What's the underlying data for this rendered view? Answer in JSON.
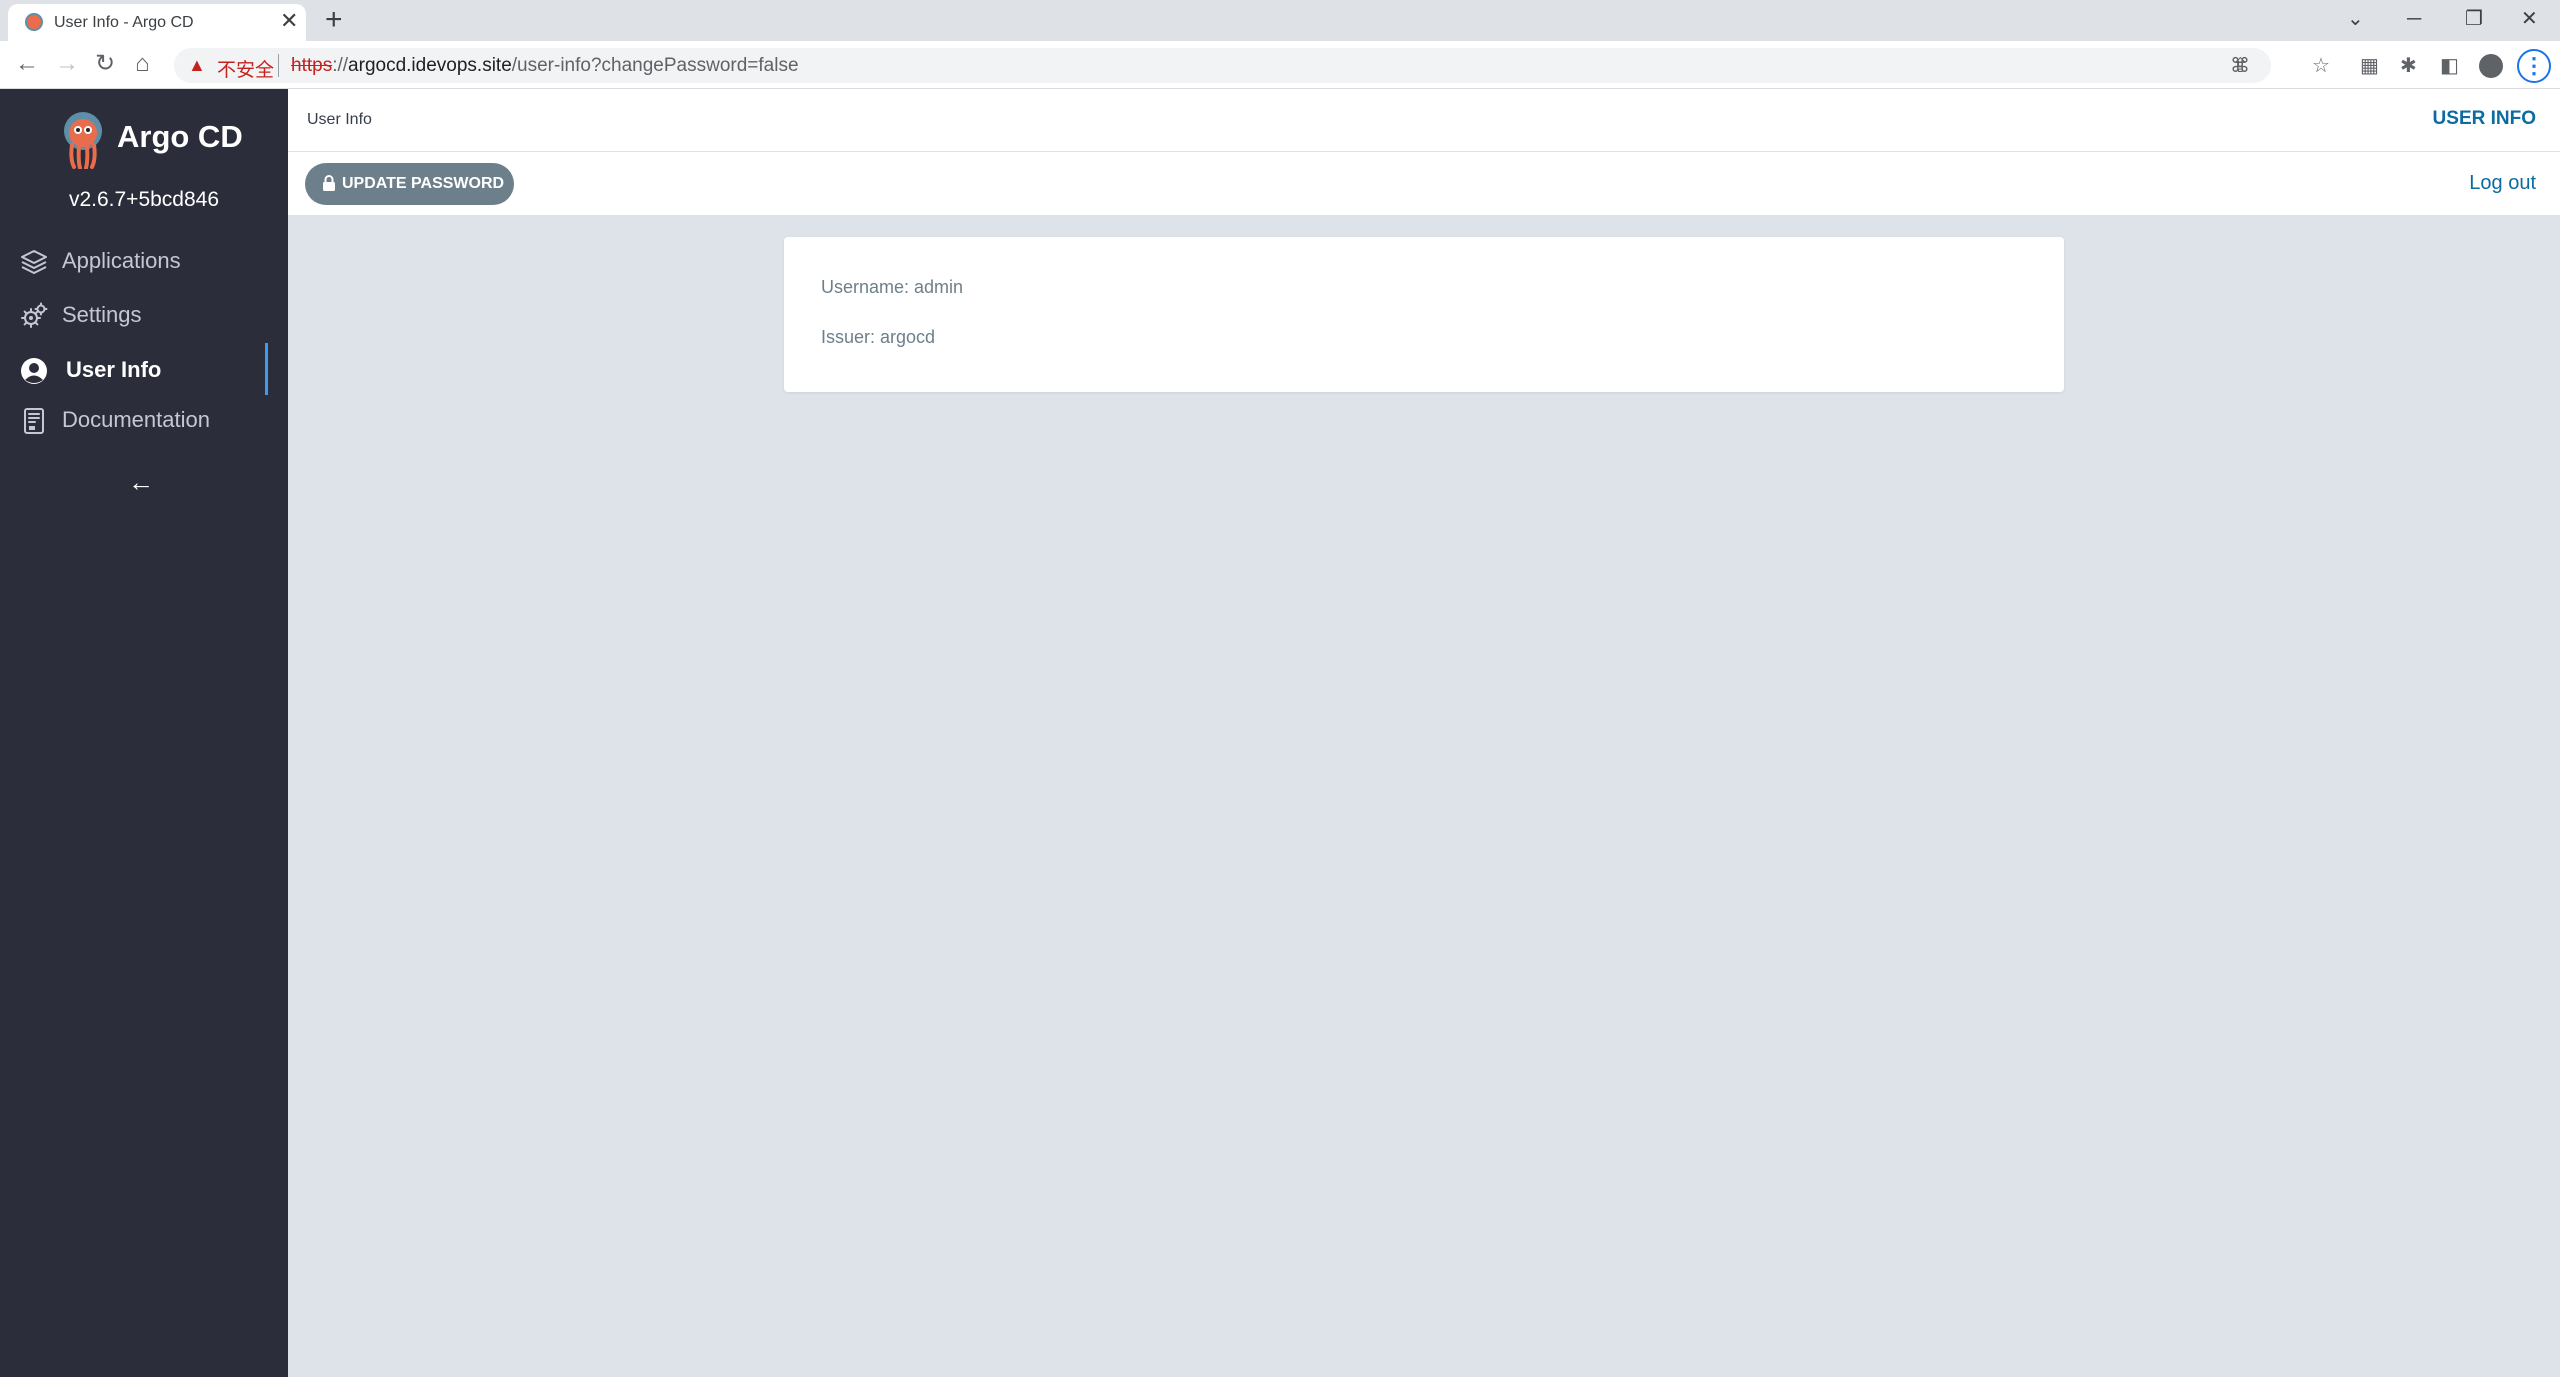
{
  "browser": {
    "tab_title": "User Info - Argo CD",
    "tab_close": "✕",
    "new_tab": "+",
    "security_label": "不安全",
    "url_scheme": "https",
    "url_sep": "://",
    "url_host": "argocd.idevops.site",
    "url_path": "/user-info?changePassword=false",
    "window_controls": {
      "minimize": "─",
      "restore": "❐",
      "close": "✕",
      "tab_search": "⌄"
    },
    "nav": {
      "back": "←",
      "forward": "→",
      "reload": "↻",
      "home": "⌂"
    }
  },
  "sidebar": {
    "app_name": "Argo CD",
    "version": "v2.6.7+5bcd846",
    "items": [
      {
        "label": "Applications",
        "icon": "layers-icon"
      },
      {
        "label": "Settings",
        "icon": "gears-icon"
      },
      {
        "label": "User Info",
        "icon": "user-circle-icon",
        "active": true
      },
      {
        "label": "Documentation",
        "icon": "book-icon"
      }
    ],
    "collapse_arrow": "←"
  },
  "header": {
    "breadcrumb": "User Info",
    "user_info_link": "USER INFO",
    "update_password": "UPDATE PASSWORD",
    "logout": "Log out"
  },
  "userinfo": {
    "username": "Username: admin",
    "issuer": "Issuer: argocd"
  },
  "colors": {
    "sidebar_bg": "#2b2d3a",
    "page_bg": "#dee3ea",
    "link": "#0d6ba1",
    "button_bg": "#6d7f8b",
    "active_indicator": "#3d9cf0"
  }
}
